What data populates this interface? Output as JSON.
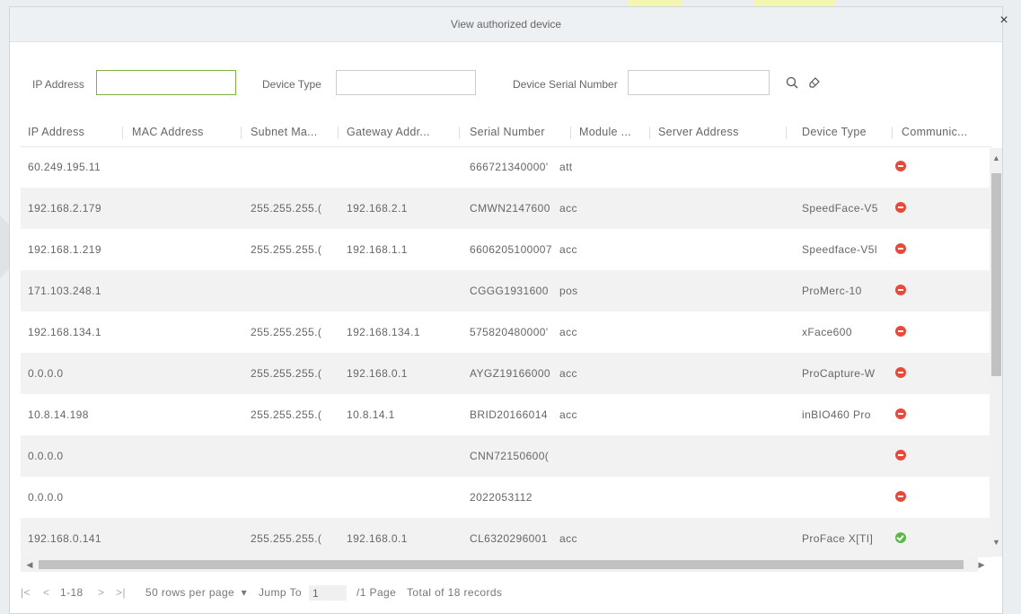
{
  "dialog": {
    "title": "View authorized device",
    "close_icon": "×"
  },
  "filters": {
    "ip_label": "IP Address",
    "ip_value": "",
    "type_label": "Device Type",
    "type_value": "",
    "serial_label": "Device Serial Number",
    "serial_value": "",
    "search_icon": "search-icon",
    "clear_icon": "eraser-icon"
  },
  "table": {
    "columns": [
      "IP Address",
      "MAC Address",
      "Subnet Ma...",
      "Gateway Addr...",
      "Serial Number",
      "Module ...",
      "Server Address",
      "Device Type",
      "Communic..."
    ],
    "rows": [
      {
        "ip": "60.249.195.11",
        "mac": "",
        "subnet": "",
        "gateway": "",
        "serial": "666721340000'",
        "module": "att",
        "server": "",
        "type": "",
        "status": "offline"
      },
      {
        "ip": "192.168.2.179",
        "mac": "",
        "subnet": "255.255.255.(",
        "gateway": "192.168.2.1",
        "serial": "CMWN2147600",
        "module": "acc",
        "server": "",
        "type": "SpeedFace-V5",
        "status": "offline"
      },
      {
        "ip": "192.168.1.219",
        "mac": "",
        "subnet": "255.255.255.(",
        "gateway": "192.168.1.1",
        "serial": "6606205100007",
        "module": "acc",
        "server": "",
        "type": "Speedface-V5l",
        "status": "offline"
      },
      {
        "ip": "171.103.248.1",
        "mac": "",
        "subnet": "",
        "gateway": "",
        "serial": "CGGG1931600",
        "module": "pos",
        "server": "",
        "type": "ProMerc-10",
        "status": "offline"
      },
      {
        "ip": "192.168.134.1",
        "mac": "",
        "subnet": "255.255.255.(",
        "gateway": "192.168.134.1",
        "serial": "575820480000'",
        "module": "acc",
        "server": "",
        "type": "xFace600",
        "status": "offline"
      },
      {
        "ip": "0.0.0.0",
        "mac": "",
        "subnet": "255.255.255.(",
        "gateway": "192.168.0.1",
        "serial": "AYGZ19166000",
        "module": "acc",
        "server": "",
        "type": "ProCapture-W",
        "status": "offline"
      },
      {
        "ip": "10.8.14.198",
        "mac": "",
        "subnet": "255.255.255.(",
        "gateway": "10.8.14.1",
        "serial": "BRID20166014",
        "module": "acc",
        "server": "",
        "type": "inBIO460 Pro",
        "status": "offline"
      },
      {
        "ip": "0.0.0.0",
        "mac": "",
        "subnet": "",
        "gateway": "",
        "serial": "CNN72150600(",
        "module": "",
        "server": "",
        "type": "",
        "status": "offline"
      },
      {
        "ip": "0.0.0.0",
        "mac": "",
        "subnet": "",
        "gateway": "",
        "serial": "2022053112",
        "module": "",
        "server": "",
        "type": "",
        "status": "offline"
      },
      {
        "ip": "192.168.0.141",
        "mac": "",
        "subnet": "255.255.255.(",
        "gateway": "192.168.0.1",
        "serial": "CL6320296001",
        "module": "acc",
        "server": "",
        "type": "ProFace X[TI]",
        "status": "online"
      }
    ]
  },
  "status_colors": {
    "offline": "#e8493a",
    "online": "#58b947"
  },
  "pagination": {
    "first": "|<",
    "prev": "<",
    "range": "1-18",
    "next": ">",
    "last": ">|",
    "rows_per_page": "50 rows per page",
    "rows_dropdown_icon": "▾",
    "jump_label": "Jump To",
    "jump_value": "1",
    "page_total": "/1 Page",
    "records_total": "Total of 18 records"
  }
}
